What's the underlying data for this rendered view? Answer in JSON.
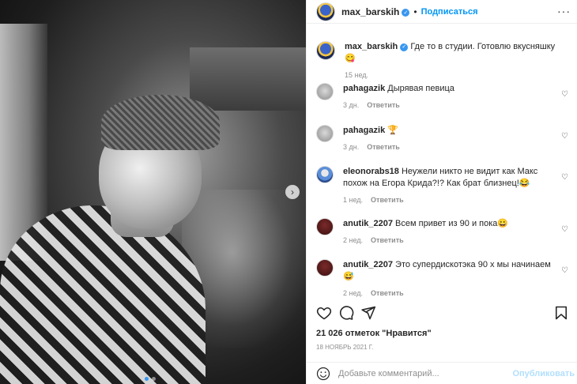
{
  "post": {
    "username": "max_barskih",
    "follow_label": "Подписаться",
    "caption": "Где то в студии. Готовлю вкусняшку 😋",
    "caption_time": "15 нед.",
    "likes": "21 026 отметок \"Нравится\"",
    "date": "18 ноябрь 2021 г.",
    "carousel": {
      "slides": 2,
      "current": 1
    }
  },
  "comments": [
    {
      "user": "pahagazik",
      "text": "Дырявая певица",
      "time": "3 дн.",
      "reply": "Ответить"
    },
    {
      "user": "pahagazik",
      "text": "🏆",
      "time": "3 дн.",
      "reply": "Ответить"
    },
    {
      "user": "eleonorabs18",
      "text": "Неужели никто не видит как Макс похож на Егора Крида?!? Как брат близнец!😂",
      "time": "1 нед.",
      "reply": "Ответить"
    },
    {
      "user": "anutik_2207",
      "text": "Всем привет из 90 и пока😀",
      "time": "2 нед.",
      "reply": "Ответить"
    },
    {
      "user": "anutik_2207",
      "text": "Это супердискотэка 90 х мы начинаем😅",
      "time": "2 нед.",
      "reply": "Ответить"
    }
  ],
  "composer": {
    "placeholder": "Добавьте комментарий...",
    "publish_label": "Опубликовать"
  },
  "icons": {
    "like": "heart-icon",
    "comment": "comment-icon",
    "share": "send-icon",
    "save": "bookmark-icon",
    "more": "more-icon",
    "emoji": "emoji-icon",
    "verified": "verified-badge-icon",
    "next": "chevron-right-icon"
  },
  "colors": {
    "accent": "#0095f6",
    "verified": "#3897f0",
    "muted": "#8e8e8e",
    "publish_disabled": "#b2dffc"
  }
}
